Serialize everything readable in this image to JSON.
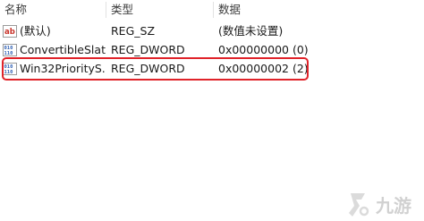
{
  "columns": {
    "name": "名称",
    "type": "类型",
    "data": "数据"
  },
  "rows": [
    {
      "icon": "string-value-icon",
      "name": "(默认)",
      "type": "REG_SZ",
      "data": "(数值未设置)"
    },
    {
      "icon": "dword-value-icon",
      "name": "ConvertibleSlat...",
      "type": "REG_DWORD",
      "data": "0x00000000 (0)"
    },
    {
      "icon": "dword-value-icon",
      "name": "Win32PriorityS...",
      "type": "REG_DWORD",
      "data": "0x00000002 (2)"
    }
  ],
  "highlight": {
    "row_index": 2,
    "color": "#e0232a"
  },
  "watermark": {
    "text": "九游"
  },
  "colors": {
    "string_icon_red": "#c8342b",
    "dword_icon_blue": "#2f5fb3"
  }
}
